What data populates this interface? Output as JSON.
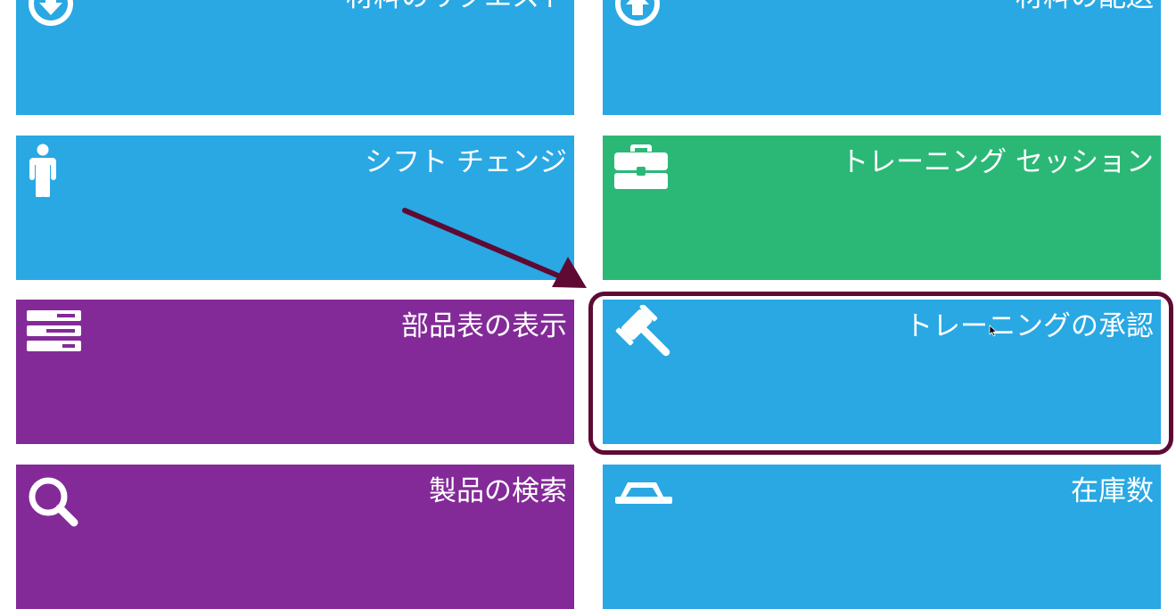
{
  "colors": {
    "blue": "#29a8e3",
    "green": "#2bb877",
    "purple": "#832a98",
    "annotation": "#5e0a33"
  },
  "tiles": [
    {
      "label": "材料のリクエスト",
      "icon": "download-circle-icon",
      "color": "#29a8e3"
    },
    {
      "label": "材料の配送",
      "icon": "upload-circle-icon",
      "color": "#29a8e3"
    },
    {
      "label": "シフト チェンジ",
      "icon": "person-icon",
      "color": "#29a8e3"
    },
    {
      "label": "トレーニング セッション",
      "icon": "briefcase-icon",
      "color": "#2bb877"
    },
    {
      "label": "部品表の表示",
      "icon": "list-stack-icon",
      "color": "#832a98"
    },
    {
      "label": "トレーニングの承認",
      "icon": "gavel-icon",
      "color": "#29a8e3"
    },
    {
      "label": "製品の検索",
      "icon": "search-icon",
      "color": "#832a98"
    },
    {
      "label": "在庫数",
      "icon": "basket-icon",
      "color": "#29a8e3"
    }
  ]
}
